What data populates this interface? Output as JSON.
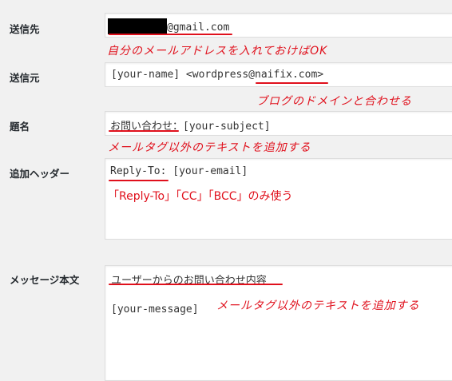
{
  "labels": {
    "to": "送信先",
    "from": "送信元",
    "subject": "題名",
    "headers": "追加ヘッダー",
    "body": "メッセージ本文"
  },
  "fields": {
    "to": {
      "value_suffix": "@gmail.com"
    },
    "from": {
      "value_prefix": "[your-name] <wordpress@",
      "value_domain": "naifix.com",
      "value_suffix": ">"
    },
    "subject": {
      "value_text": "お問い合わせ",
      "value_suffix": "：[your-subject]"
    },
    "headers": {
      "value_key": "Reply-To:",
      "value_rest": " [your-email]"
    },
    "body": {
      "line1": "ユーザーからのお問い合わせ内容",
      "line2": "[your-message]"
    }
  },
  "annotations": {
    "to": "自分のメールアドレスを入れておけばOK",
    "from": "ブログのドメインと合わせる",
    "subject": "メールタグ以外のテキストを追加する",
    "headers": "「Reply-To」「CC」「BCC」のみ使う",
    "body": "メールタグ以外のテキストを追加する"
  },
  "colors": {
    "annotation": "#e0101c",
    "label": "#23282d",
    "background": "#f1f1f1"
  }
}
